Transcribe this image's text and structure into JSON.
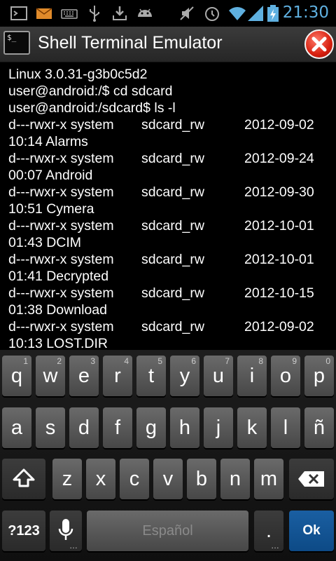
{
  "status_bar": {
    "time": "21:30",
    "icons": [
      "terminal-notification-icon",
      "email-icon",
      "keyboard-icon",
      "usb-icon",
      "download-icon",
      "android-debug-icon",
      "mute-icon",
      "alarm-icon",
      "wifi-icon",
      "signal-icon",
      "battery-charging-icon"
    ],
    "accent": "#5fb0e0"
  },
  "app": {
    "title": "Shell Terminal Emulator",
    "icon_text": "$_"
  },
  "terminal": {
    "lines": [
      "Linux 3.0.31-g3b0c5d2",
      "user@android:/$ cd sdcard",
      "user@android:/sdcard$ ls -l"
    ],
    "entries": [
      {
        "perms": "d---rwxr-x system",
        "group": "sdcard_rw",
        "date": "2012-09-02",
        "time_name": "10:14 Alarms"
      },
      {
        "perms": "d---rwxr-x system",
        "group": "sdcard_rw",
        "date": "2012-09-24",
        "time_name": "00:07 Android"
      },
      {
        "perms": "d---rwxr-x system",
        "group": "sdcard_rw",
        "date": "2012-09-30",
        "time_name": "10:51 Cymera"
      },
      {
        "perms": "d---rwxr-x system",
        "group": "sdcard_rw",
        "date": "2012-10-01",
        "time_name": "01:43 DCIM"
      },
      {
        "perms": "d---rwxr-x system",
        "group": "sdcard_rw",
        "date": "2012-10-01",
        "time_name": "01:41 Decrypted"
      },
      {
        "perms": "d---rwxr-x system",
        "group": "sdcard_rw",
        "date": "2012-10-15",
        "time_name": "01:38 Download"
      },
      {
        "perms": "d---rwxr-x system",
        "group": "sdcard_rw",
        "date": "2012-09-02",
        "time_name": "10:13 LOST.DIR"
      }
    ]
  },
  "keyboard": {
    "row1": [
      {
        "label": "q",
        "hint": "1"
      },
      {
        "label": "w",
        "hint": "2"
      },
      {
        "label": "e",
        "hint": "3"
      },
      {
        "label": "r",
        "hint": "4"
      },
      {
        "label": "t",
        "hint": "5"
      },
      {
        "label": "y",
        "hint": "6"
      },
      {
        "label": "u",
        "hint": "7"
      },
      {
        "label": "i",
        "hint": "8"
      },
      {
        "label": "o",
        "hint": "9"
      },
      {
        "label": "p",
        "hint": "0"
      }
    ],
    "row2": [
      "a",
      "s",
      "d",
      "f",
      "g",
      "h",
      "j",
      "k",
      "l",
      "ñ"
    ],
    "row3": [
      "z",
      "x",
      "c",
      "v",
      "b",
      "n",
      "m"
    ],
    "symbols_label": "?123",
    "space_label": "Español",
    "period_label": ".",
    "ok_label": "Ok"
  }
}
